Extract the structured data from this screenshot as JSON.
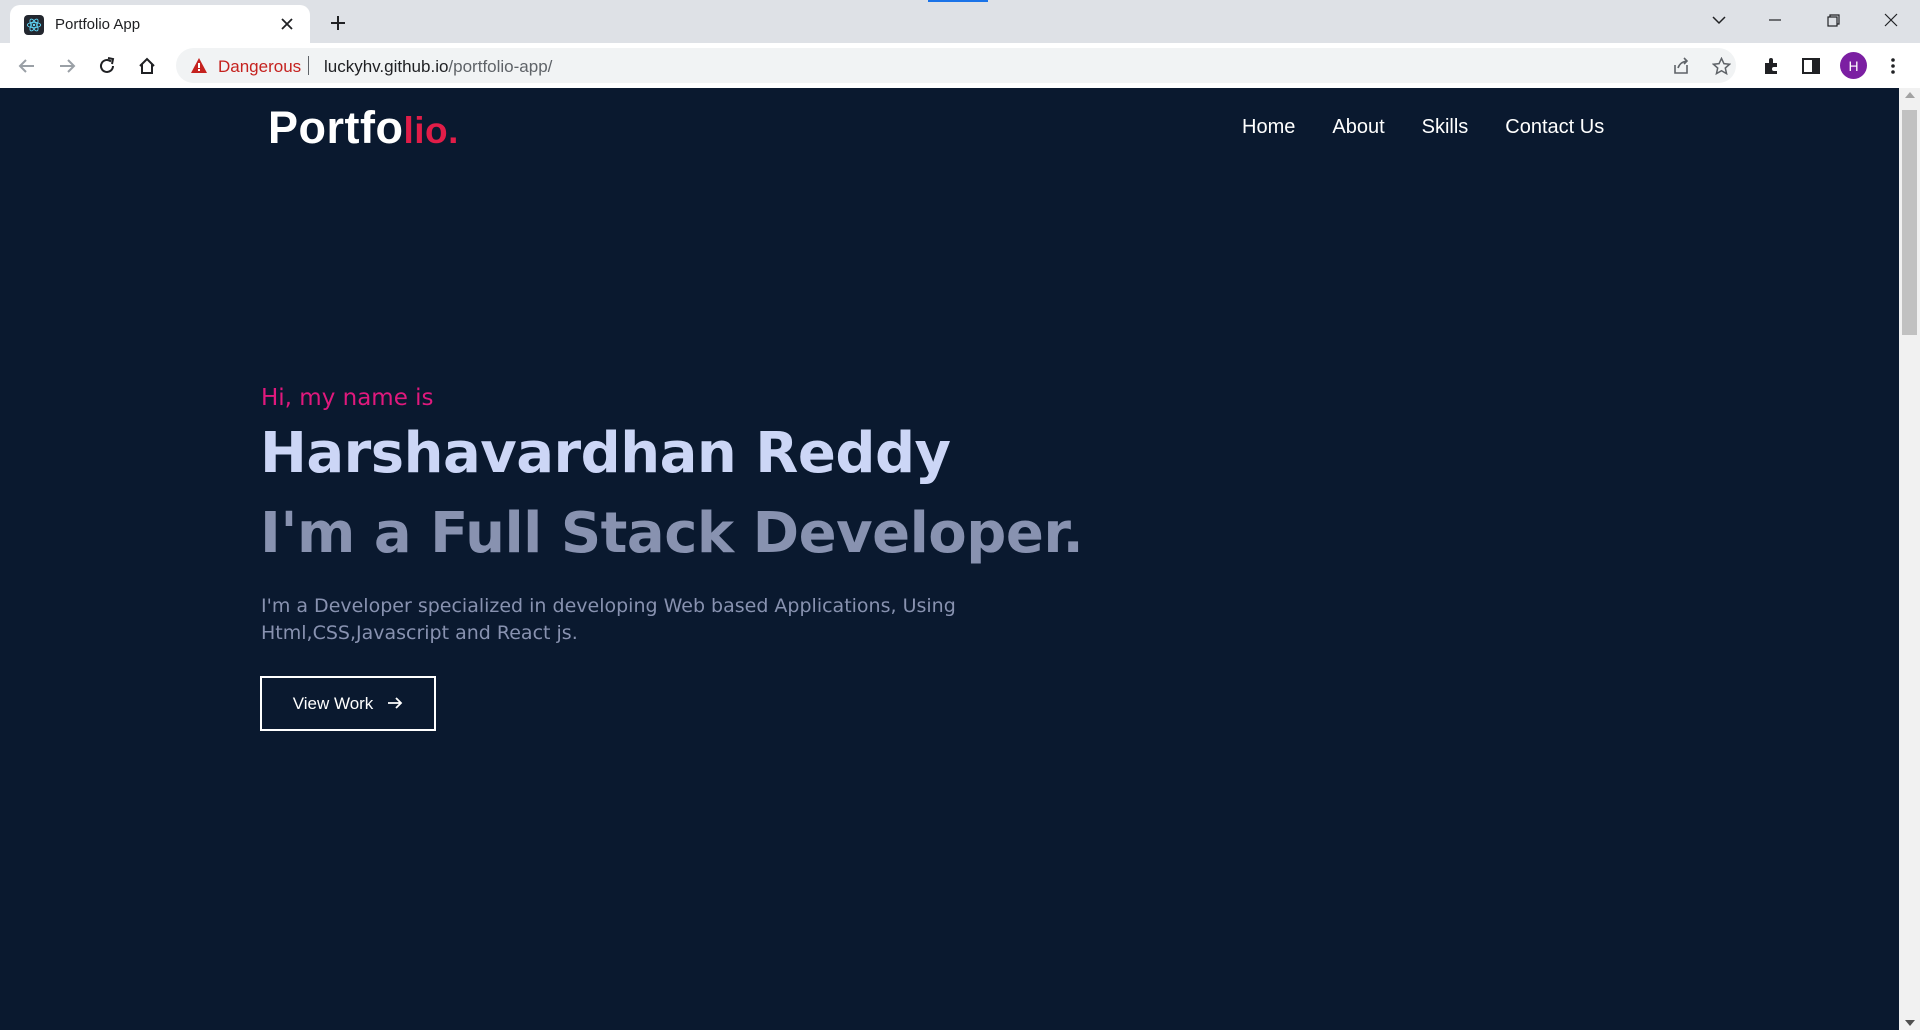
{
  "browser": {
    "tab": {
      "title": "Portfolio App",
      "favicon": "react-logo-icon"
    },
    "toolbar": {
      "security_label": "Dangerous",
      "url_host": "luckyhv.github.io",
      "url_path": "/portfolio-app/",
      "profile_initial": "H"
    },
    "colors": {
      "danger": "#c5221f",
      "profile": "#7b1fa2"
    }
  },
  "page": {
    "logo": {
      "main": "Portfo",
      "accent": "lio."
    },
    "nav": [
      {
        "label": "Home"
      },
      {
        "label": "About"
      },
      {
        "label": "Skills"
      },
      {
        "label": "Contact Us"
      }
    ],
    "hero": {
      "intro": "Hi, my name is",
      "name": "Harshavardhan Reddy",
      "role": "I'm a Full Stack Developer.",
      "description": "I'm a Developer specialized in developing Web based Applications, Using Html,CSS,Javascript and React js.",
      "cta_label": "View Work",
      "cta_icon": "arrow-right-icon"
    },
    "colors": {
      "background": "#0a192f",
      "accent": "#e11d48",
      "intro": "#e0197d",
      "name": "#ccd6f6",
      "muted": "#8892b0"
    }
  }
}
